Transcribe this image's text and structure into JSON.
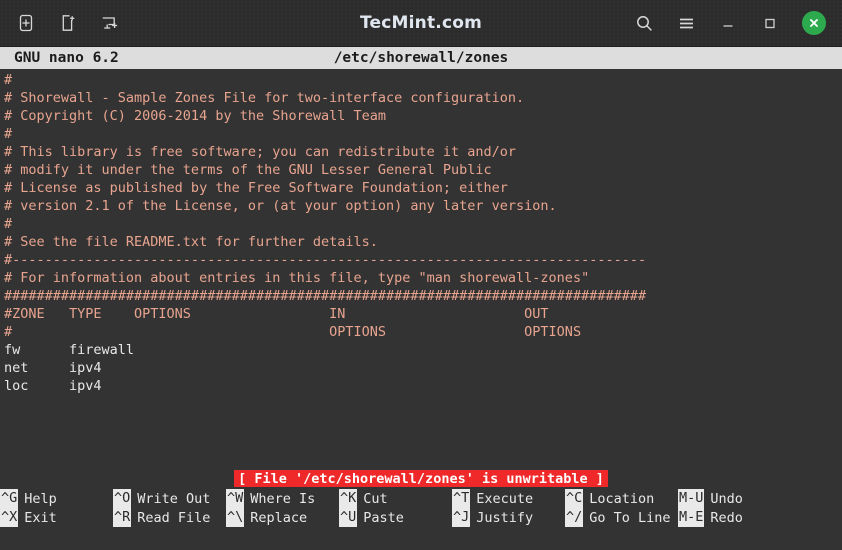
{
  "window": {
    "title": "TecMint.com",
    "left_icons": [
      "new-tab-icon",
      "new-window-icon",
      "new-terminal-icon"
    ],
    "right_icons": [
      "search-icon",
      "menu-icon"
    ],
    "controls": {
      "minimize": "minimize-button",
      "maximize": "maximize-button",
      "close": "close-button",
      "close_accent": "#2eaa4e"
    }
  },
  "nano": {
    "version": "GNU nano 6.2",
    "filename": "/etc/shorewall/zones",
    "comment_color": "#e8a48f",
    "text_color": "#e8e8e8",
    "background_color": "#333333"
  },
  "editor": {
    "lines": [
      {
        "text": "#",
        "kind": "comment"
      },
      {
        "text": "# Shorewall - Sample Zones File for two-interface configuration.",
        "kind": "comment"
      },
      {
        "text": "# Copyright (C) 2006-2014 by the Shorewall Team",
        "kind": "comment"
      },
      {
        "text": "#",
        "kind": "comment"
      },
      {
        "text": "# This library is free software; you can redistribute it and/or",
        "kind": "comment"
      },
      {
        "text": "# modify it under the terms of the GNU Lesser General Public",
        "kind": "comment"
      },
      {
        "text": "# License as published by the Free Software Foundation; either",
        "kind": "comment"
      },
      {
        "text": "# version 2.1 of the License, or (at your option) any later version.",
        "kind": "comment"
      },
      {
        "text": "#",
        "kind": "comment"
      },
      {
        "text": "# See the file README.txt for further details.",
        "kind": "comment"
      },
      {
        "text": "#------------------------------------------------------------------------------",
        "kind": "comment"
      },
      {
        "text": "# For information about entries in this file, type \"man shorewall-zones\"",
        "kind": "comment"
      },
      {
        "text": "###############################################################################",
        "kind": "comment"
      },
      {
        "text": "#ZONE   TYPE    OPTIONS                 IN                      OUT",
        "kind": "comment"
      },
      {
        "text": "#                                       OPTIONS                 OPTIONS",
        "kind": "comment"
      },
      {
        "text": "fw      firewall",
        "kind": "data"
      },
      {
        "text": "net     ipv4",
        "kind": "data"
      },
      {
        "text": "loc     ipv4",
        "kind": "data"
      }
    ],
    "table": {
      "columns": [
        "#ZONE",
        "TYPE",
        "OPTIONS",
        "IN OPTIONS",
        "OUT OPTIONS"
      ],
      "rows": [
        [
          "fw",
          "firewall",
          "",
          "",
          ""
        ],
        [
          "net",
          "ipv4",
          "",
          "",
          ""
        ],
        [
          "loc",
          "ipv4",
          "",
          "",
          ""
        ]
      ]
    }
  },
  "status": {
    "message": "[ File '/etc/shorewall/zones' is unwritable ]",
    "background_color": "#ef2929",
    "text_color": "#ffffff"
  },
  "shortcuts": {
    "row1": [
      {
        "key": "^G",
        "label": "Help"
      },
      {
        "key": "^O",
        "label": "Write Out"
      },
      {
        "key": "^W",
        "label": "Where Is"
      },
      {
        "key": "^K",
        "label": "Cut"
      },
      {
        "key": "^T",
        "label": "Execute"
      },
      {
        "key": "^C",
        "label": "Location"
      },
      {
        "key": "M-U",
        "label": "Undo"
      }
    ],
    "row2": [
      {
        "key": "^X",
        "label": "Exit"
      },
      {
        "key": "^R",
        "label": "Read File"
      },
      {
        "key": "^\\",
        "label": "Replace"
      },
      {
        "key": "^U",
        "label": "Paste"
      },
      {
        "key": "^J",
        "label": "Justify"
      },
      {
        "key": "^/",
        "label": "Go To Line"
      },
      {
        "key": "M-E",
        "label": "Redo"
      }
    ]
  }
}
